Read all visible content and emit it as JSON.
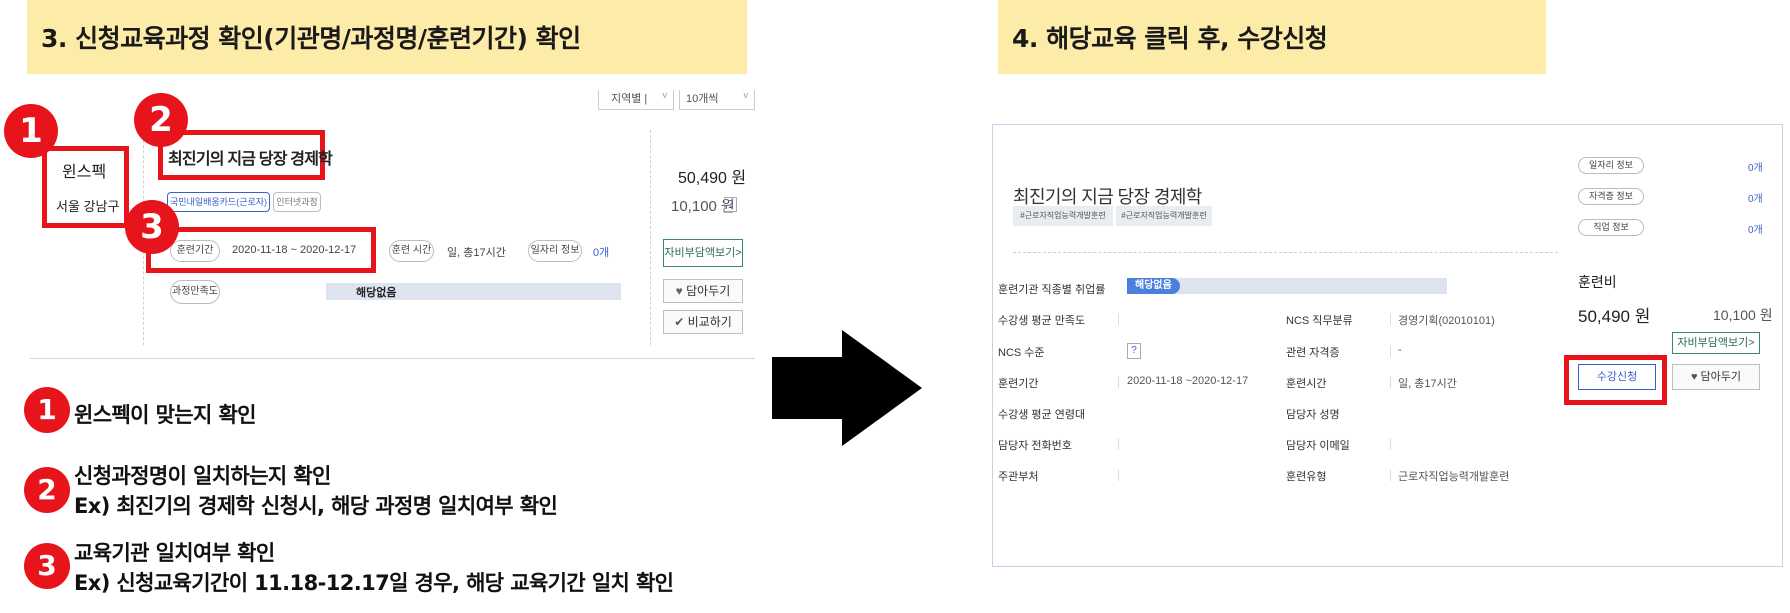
{
  "left": {
    "header_title": "3. 신청교육과정 확인(기관명/과정명/훈련기간) 확인",
    "sort_select": "지역별 |",
    "count_select": "10개씩",
    "org_name": "윈스펙",
    "org_location": "서울 강남구",
    "course_title": "최진기의 지금 당장 경제학",
    "tags": [
      "국민내일배움카드(근로자)",
      "인터넷과정"
    ],
    "period_label": "훈련기간",
    "period_value": "2020-11-18 ~ 2020-12-17",
    "time_label": "훈련 시간",
    "time_value": "일, 총17시간",
    "job_info_label": "일자리 정보",
    "job_info_count": "0개",
    "satisfaction_label": "과정만족도",
    "satisfaction_value": "해당없음",
    "price": "50,490 원",
    "sub_price": "10,100 원",
    "help": "?",
    "self_pay_btn": "자비부담액보기>",
    "wish_btn": "담아두기",
    "compare_btn": "비교하기",
    "badges": [
      "1",
      "2",
      "3"
    ],
    "desc1": "윈스펙이 맞는지 확인",
    "desc2_line1": "신청과정명이 일치하는지 확인",
    "desc2_line2": "Ex) 최진기의 경제학 신청시, 해당 과정명 일치여부 확인",
    "desc3_line1": "교육기관 일치여부 확인",
    "desc3_line2": "Ex) 신청교육기간이 11.18-12.17일 경우, 해당 교육기간 일치 확인"
  },
  "right": {
    "header_title": "4. 해당교육 클릭 후, 수강신청",
    "course_title": "최진기의 지금 당장 경제학",
    "hashtags": [
      "#근로자직업능력개발훈련",
      "#근로자직업능력개발훈련"
    ],
    "side_items": [
      {
        "label": "일자리 정보",
        "count": "0개"
      },
      {
        "label": "자격증 정보",
        "count": "0개"
      },
      {
        "label": "직업 정보",
        "count": "0개"
      }
    ],
    "employment_label": "훈련기관 직종별 취업률",
    "employment_value": "해당없음",
    "rows_left": [
      {
        "label": "수강생 평균 만족도",
        "value": ""
      },
      {
        "label": "NCS 수준",
        "value": "?"
      },
      {
        "label": "훈련기간",
        "value": "2020-11-18 ~2020-12-17"
      },
      {
        "label": "수강생 평균 연령대",
        "value": ""
      },
      {
        "label": "담당자 전화번호",
        "value": ""
      },
      {
        "label": "주관부처",
        "value": ""
      }
    ],
    "rows_right": [
      {
        "label": "NCS 직무분류",
        "value": "경영기획(02010101)"
      },
      {
        "label": "관련 자격증",
        "value": "-"
      },
      {
        "label": "훈련시간",
        "value": "일, 총17시간"
      },
      {
        "label": "담당자 성명",
        "value": ""
      },
      {
        "label": "담당자 이메일",
        "value": ""
      },
      {
        "label": "훈련유형",
        "value": "근로자직업능력개발훈련"
      }
    ],
    "fee_label": "훈련비",
    "fee_price": "50,490 원",
    "fee_sub": "10,100 원",
    "self_pay_btn": "자비부담액보기>",
    "enroll_btn": "수강신청",
    "wish_btn": "담아두기"
  },
  "colors": {
    "badge_red": "#e8141b",
    "header_yellow": "#fdeba8",
    "accent_blue": "#3a5fcd"
  }
}
